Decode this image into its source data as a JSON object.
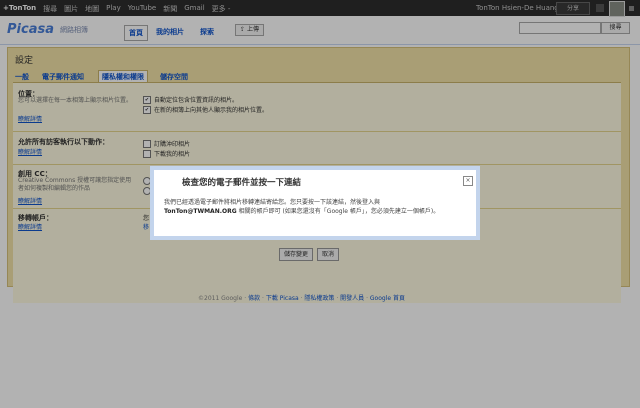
{
  "topbar": {
    "nav": [
      "+TonTon",
      "搜尋",
      "圖片",
      "地圖",
      "Play",
      "YouTube",
      "新聞",
      "Gmail",
      "更多 -"
    ],
    "user": "TonTon Hsien-De Huang",
    "share_label": "分享"
  },
  "header": {
    "logo": "Picasa",
    "logo_sub": "網路相簿",
    "tabs": [
      "首頁",
      "我的相片",
      "探索"
    ],
    "upload_label": "上傳",
    "search_button": "搜尋"
  },
  "settings": {
    "title": "設定",
    "tabs": [
      "一般",
      "電子郵件通知",
      "隱私權和權限",
      "儲存空間"
    ],
    "sections": {
      "location": {
        "label": "位置：",
        "desc": "您可以選擇在每一本相簿上顯示相片位置。",
        "learn": "瞭解詳情",
        "options": [
          "自動定位包含位置資訊的相片。",
          "在新的相簿上向其他人顯示我的相片位置。"
        ]
      },
      "allow": {
        "label": "允許所有訪客執行以下動作：",
        "learn": "瞭解詳情",
        "options": [
          "訂購沖印相片",
          "下載我的相片"
        ]
      },
      "cc": {
        "label": "創用 CC：",
        "desc": "Creative Commons 授權可讓您指定使用者如何複製和編輯您的作品",
        "learn": "瞭解詳情"
      },
      "move": {
        "label": "移轉帳戶：",
        "learn": "瞭解詳情",
        "value": "您",
        "value2": "移"
      }
    },
    "save_label": "儲存變更",
    "cancel_label": "取消"
  },
  "footer": {
    "copyright": "©2011 Google",
    "links": [
      "條款",
      "下載 Picasa",
      "隱私權政策",
      "開發人員",
      "Google 首頁"
    ]
  },
  "dialog": {
    "title": "檢查您的電子郵件並按一下連結",
    "close": "×",
    "body_1": "我們已經透過電子郵件將相片移轉連結寄給您。您只要按一下該連結，然後登入與",
    "email": "TonTon@TWMAN.ORG",
    "body_2": " 相關的帳戶即可 (如果您還沒有「Google 帳戶」，您必須先建立一個帳戶)。"
  }
}
